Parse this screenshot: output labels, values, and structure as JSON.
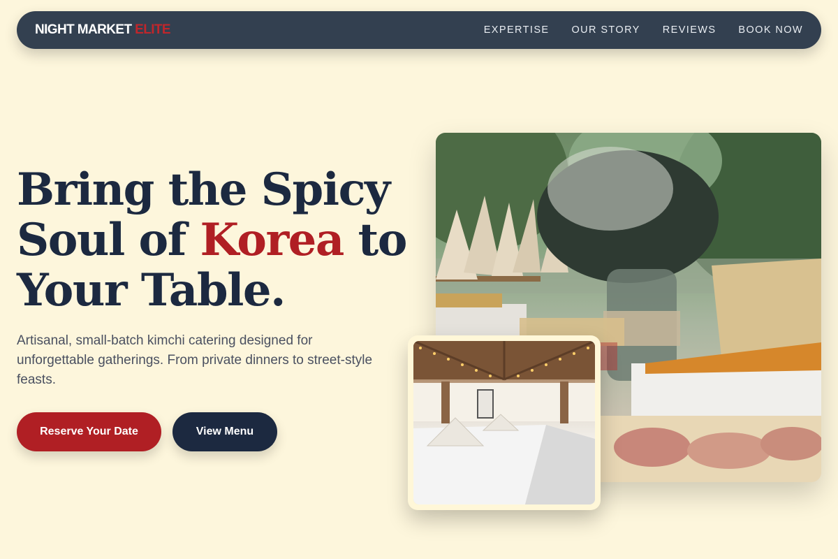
{
  "nav": {
    "logo_main": "NIGHT MARKET",
    "logo_accent": "ELITE",
    "links": [
      "EXPERTISE",
      "OUR STORY",
      "REVIEWS",
      "BOOK NOW"
    ]
  },
  "hero": {
    "headline_part1": "Bring the Spicy Soul of ",
    "headline_highlight": "Korea",
    "headline_part2": " to Your Table.",
    "subtext": "Artisanal, small-batch kimchi catering designed for unforgettable gatherings. From private dinners to street-style feasts.",
    "primary_button": "Reserve Your Date",
    "secondary_button": "View Menu"
  },
  "images": {
    "main_alt": "Outdoor catering buffet with snack boxes, paper cones and flower centerpiece",
    "secondary_alt": "Long banquet table with white linens under string lights"
  },
  "colors": {
    "background": "#fdf6dc",
    "nav_bg": "#334050",
    "accent_red": "#b01f24",
    "navy": "#1c2940"
  }
}
